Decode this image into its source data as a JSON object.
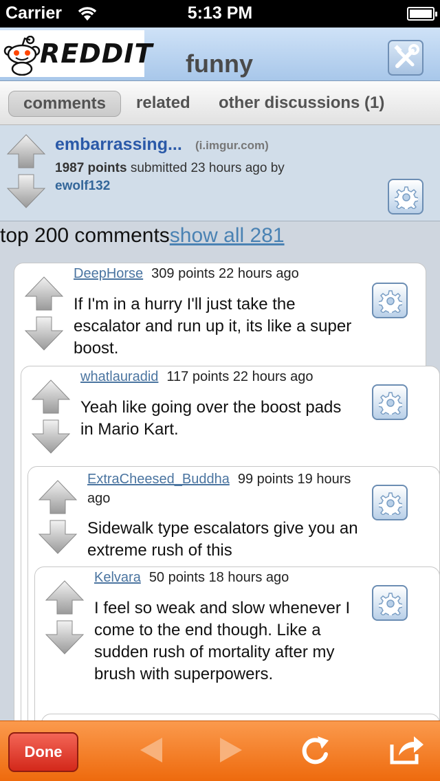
{
  "status_bar": {
    "carrier": "Carrier",
    "time": "5:13 PM"
  },
  "header": {
    "logo_text": "REDDIT",
    "subreddit": "funny",
    "tools_icon": "tools-icon"
  },
  "tabs": [
    {
      "label": "comments",
      "active": true
    },
    {
      "label": "related",
      "active": false
    },
    {
      "label": "other discussions (1)",
      "active": false
    }
  ],
  "post": {
    "title": "embarrassing...",
    "domain": "(i.imgur.com)",
    "points": "1987 points",
    "submitted": "submitted 23 hours ago",
    "by": "by",
    "author": "ewolf132"
  },
  "comments_header": {
    "label": "top 200 comments",
    "show_all": "show all 281"
  },
  "comments": [
    {
      "user": "DeepHorse",
      "meta": "309 points 22 hours ago",
      "body": "If I'm in a hurry I'll just take the escalator and run up it, its like a super boost."
    },
    {
      "user": "whatlauradid",
      "meta": "117 points 22 hours ago",
      "body": "Yeah like going over the boost pads in Mario Kart."
    },
    {
      "user": "ExtraCheesed_Buddha",
      "meta": "99 points 19 hours ago",
      "body": "Sidewalk type escalators give you an extreme rush of this"
    },
    {
      "user": "Kelvara",
      "meta": "50 points 18 hours ago",
      "body": "I feel so weak and slow whenever I come to the end though. Like a sudden rush of mortality after my brush with superpowers."
    }
  ],
  "toolbar": {
    "done_label": "Done"
  },
  "colors": {
    "toolbar": "#f27a22",
    "header": "#b9d3ee",
    "link": "#2a59a8",
    "done": "#d3281a"
  }
}
